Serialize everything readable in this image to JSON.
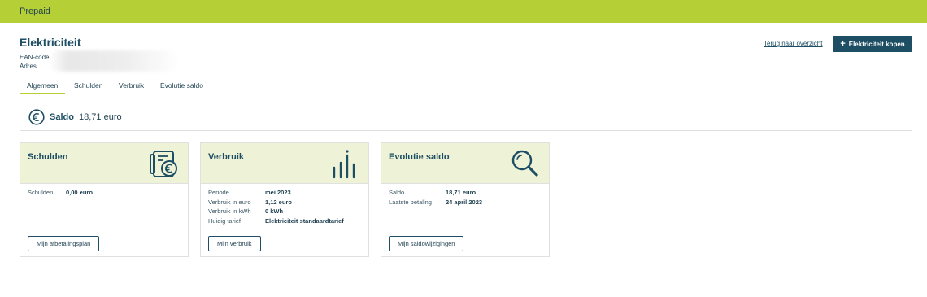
{
  "topbar": {
    "title": "Prepaid"
  },
  "header": {
    "title": "Elektriciteit",
    "ean_label": "EAN-code",
    "address_label": "Adres",
    "back_link": "Terug naar overzicht",
    "buy_button": "Elektriciteit kopen"
  },
  "tabs": [
    {
      "label": "Algemeen",
      "active": true
    },
    {
      "label": "Schulden",
      "active": false
    },
    {
      "label": "Verbruik",
      "active": false
    },
    {
      "label": "Evolutie saldo",
      "active": false
    }
  ],
  "saldo": {
    "label": "Saldo",
    "value": "18,71 euro"
  },
  "cards": [
    {
      "title": "Schulden",
      "icon": "invoice-euro-icon",
      "rows": [
        {
          "key": "Schulden",
          "value": "0,00 euro"
        }
      ],
      "button": "Mijn afbetalingsplan"
    },
    {
      "title": "Verbruik",
      "icon": "bar-chart-icon",
      "rows": [
        {
          "key": "Periode",
          "value": "mei 2023"
        },
        {
          "key": "Verbruik in euro",
          "value": "1,12 euro"
        },
        {
          "key": "Verbruik in kWh",
          "value": "0 kWh"
        },
        {
          "key": "Huidig tarief",
          "value": "Elektriciteit standaardtarief"
        }
      ],
      "button": "Mijn verbruik"
    },
    {
      "title": "Evolutie saldo",
      "icon": "magnifier-icon",
      "rows": [
        {
          "key": "Saldo",
          "value": "18,71 euro"
        },
        {
          "key": "Laatste betaling",
          "value": "24 april 2023"
        }
      ],
      "button": "Mijn saldowijzigingen"
    }
  ],
  "colors": {
    "brand_green": "#b5cf37",
    "primary_dark": "#1d4e63",
    "card_head_bg": "#eef2d7"
  }
}
